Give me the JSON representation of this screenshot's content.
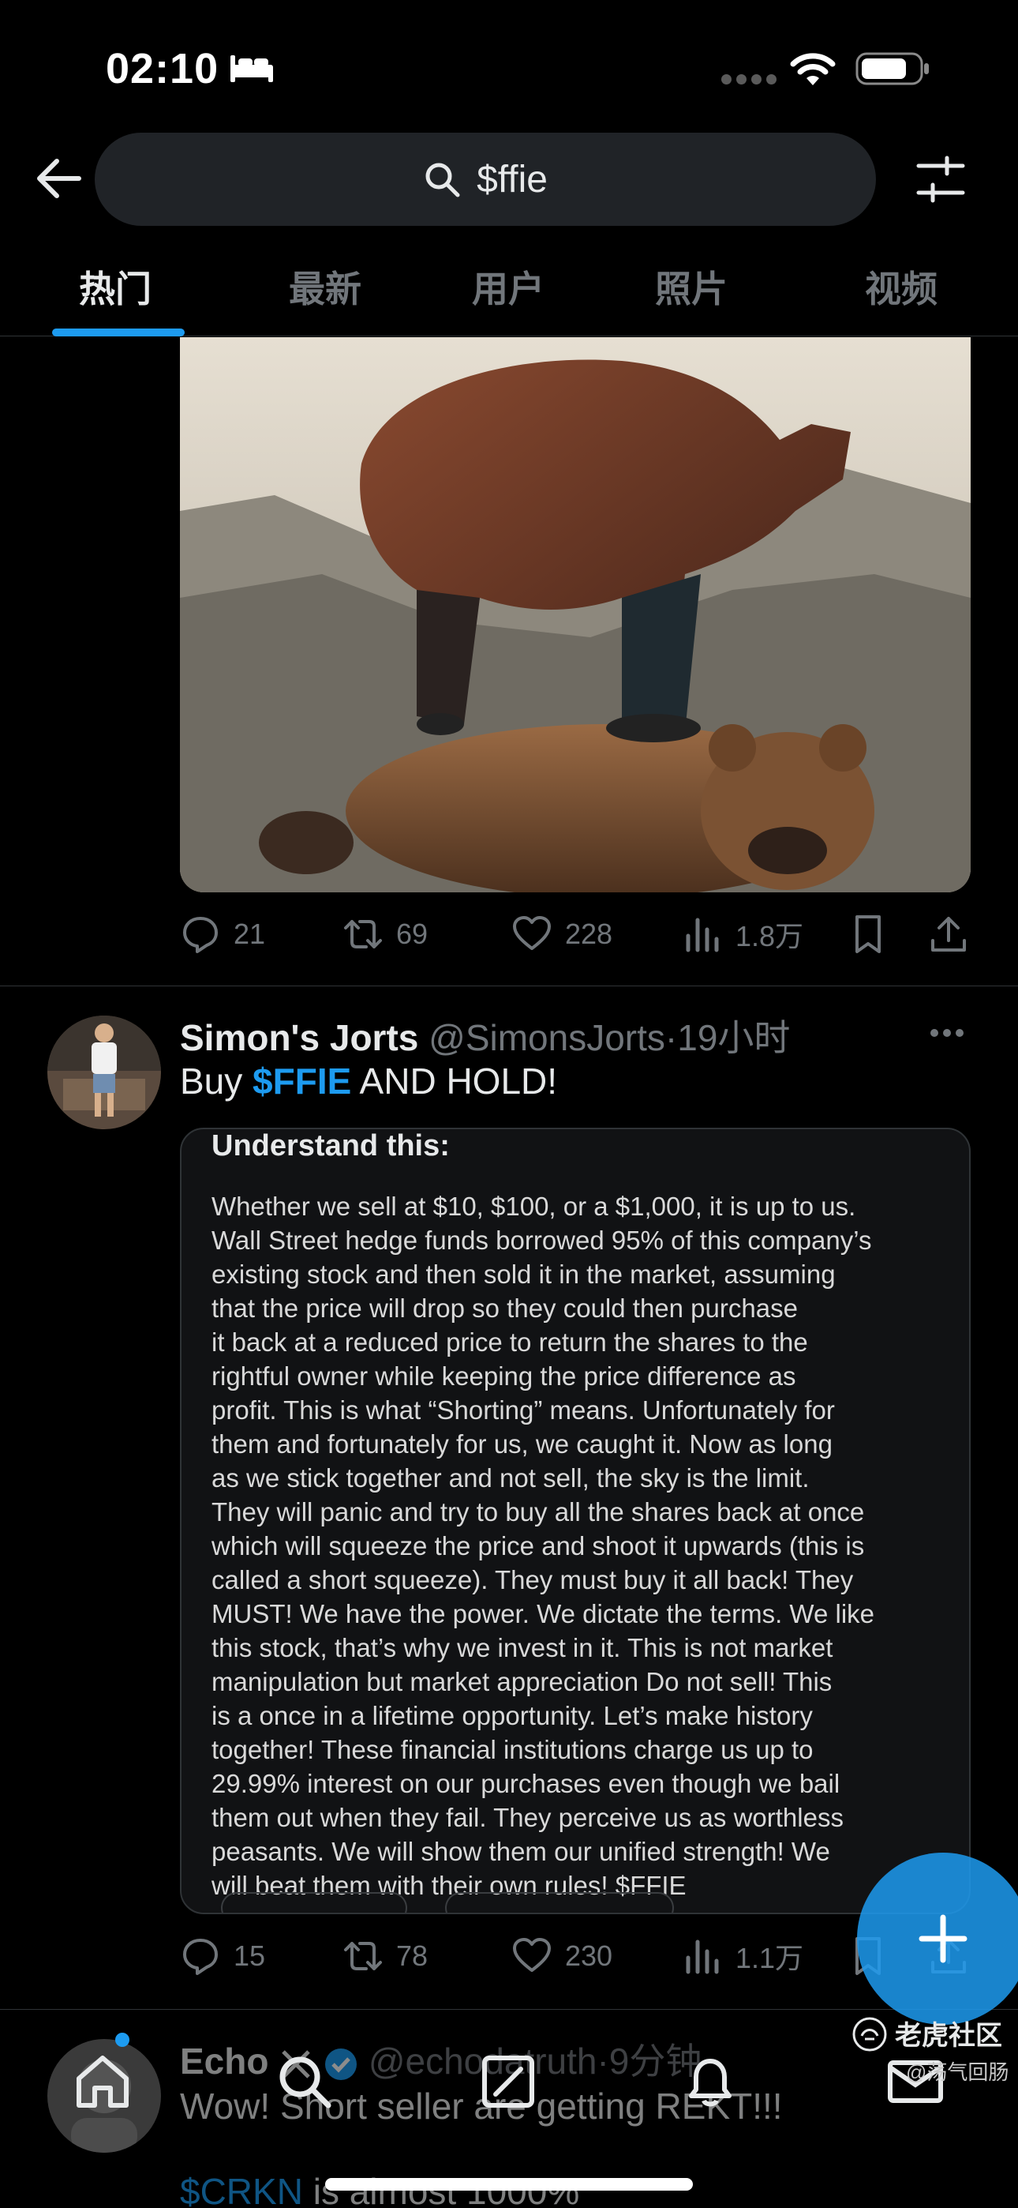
{
  "status_bar": {
    "time": "02:10"
  },
  "search": {
    "query": "$ffie"
  },
  "tabs": [
    {
      "label": "热门",
      "active": true
    },
    {
      "label": "最新",
      "active": false
    },
    {
      "label": "用户",
      "active": false
    },
    {
      "label": "照片",
      "active": false
    },
    {
      "label": "视频",
      "active": false
    }
  ],
  "tweet1": {
    "replies": "21",
    "retweets": "69",
    "likes": "228",
    "views": "1.8万"
  },
  "tweet2": {
    "name": "Simon's Jorts",
    "handle": "@SimonsJorts",
    "separator": "·",
    "time": "19小时",
    "text_prefix": "Buy ",
    "text_cashtag": "$FFIE",
    "text_suffix": " AND HOLD!",
    "embed": {
      "title": "Understand this:",
      "lines": [
        "Whether we sell at $10, $100, or a $1,000, it is up to us.",
        "Wall Street hedge funds borrowed 95% of this company’s",
        "existing stock and then sold it in the market, assuming",
        "that the price will drop so they could then purchase",
        "it back at a reduced price to return the shares to the",
        "rightful owner while keeping the price difference as",
        "profit. This is what “Shorting” means. Unfortunately for",
        "them and fortunately for us, we caught it. Now as long",
        "as we stick together and not sell, the sky is the limit.",
        "They will panic and try to buy all the shares back at once",
        "which will squeeze the price and shoot it upwards (this is",
        "called a short squeeze). They must buy it all back! They",
        "MUST! We have the power. We dictate the terms. We like",
        "this stock, that’s why we invest in it. This is not market",
        "manipulation but market appreciation Do not sell! This",
        "is a once in a lifetime opportunity. Let’s make history",
        "together! These financial institutions charge us up to",
        "29.99% interest on our purchases even though we bail",
        "them out when they fail. They perceive us as worthless",
        "peasants. We will show them our unified strength! We",
        "will beat them with their own rules! $FFIE"
      ]
    },
    "replies": "15",
    "retweets": "78",
    "likes": "230",
    "views": "1.1万"
  },
  "tweet3": {
    "name": "Echo",
    "handle": "@echodatruth",
    "separator": "·",
    "time": "9分钟",
    "text": "Wow! Short seller are getting REKT!!!",
    "cashtag": "$CRKN",
    "text2": " is almost 1000%"
  },
  "watermark": {
    "title": "老虎社区",
    "subtitle": "@荡气回肠"
  },
  "colors": {
    "accent": "#1d9bf0",
    "muted": "#71767b",
    "text": "#e7e9ea",
    "bg": "#000000"
  },
  "icons": [
    "back-arrow-icon",
    "search-icon",
    "filter-icon",
    "reply-icon",
    "retweet-icon",
    "like-icon",
    "views-icon",
    "bookmark-icon",
    "share-icon",
    "more-icon",
    "compose-icon",
    "home-icon",
    "explore-icon",
    "grok-icon",
    "notifications-icon",
    "messages-icon",
    "verified-icon"
  ]
}
